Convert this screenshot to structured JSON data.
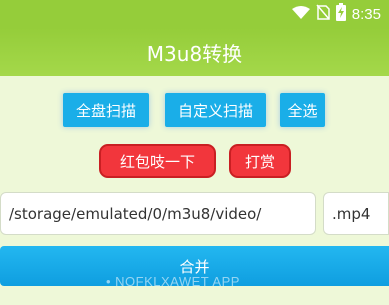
{
  "status_bar": {
    "time": "8:35",
    "icons": [
      "wifi-icon",
      "no-sim-icon",
      "battery-charging-icon"
    ]
  },
  "app_bar": {
    "title": "M3u8转换"
  },
  "scan_buttons": {
    "full_scan": "全盘扫描",
    "custom_scan": "自定义扫描",
    "select_all": "全选"
  },
  "red_buttons": {
    "red_packet": "红包吱一下",
    "reward": "打赏"
  },
  "path_field": {
    "value": "/storage/emulated/0/m3u8/video/"
  },
  "ext_field": {
    "value": ".mp4"
  },
  "merge_button": {
    "label": "合并"
  },
  "watermark": {
    "text": "• NOFKLXAWET APP"
  },
  "colors": {
    "header_green": "#95cd3a",
    "background": "#eef8d8",
    "button_blue": "#1aaee8",
    "button_red": "#f2363c"
  }
}
